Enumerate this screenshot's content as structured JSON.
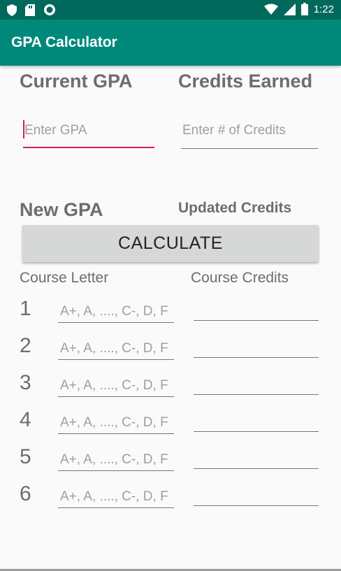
{
  "status_bar": {
    "time": "1:22",
    "icons": [
      "shield-icon",
      "sd-card-icon",
      "record-icon",
      "wifi-icon",
      "signal-icon",
      "battery-icon"
    ]
  },
  "app_bar": {
    "title": "GPA Calculator"
  },
  "current": {
    "gpa_label": "Current GPA",
    "credits_label": "Credits Earned",
    "gpa_placeholder": "Enter GPA",
    "credits_placeholder": "Enter # of Credits"
  },
  "result": {
    "new_gpa_label": "New GPA",
    "updated_credits_label": "Updated Credits"
  },
  "calculate_label": "CALCULATE",
  "courses": {
    "letter_header": "Course Letter",
    "credits_header": "Course Credits",
    "rows": [
      {
        "num": "1",
        "letter_placeholder": "A+, A, ...., C-, D, F"
      },
      {
        "num": "2",
        "letter_placeholder": "A+, A, ...., C-, D, F"
      },
      {
        "num": "3",
        "letter_placeholder": "A+, A, ...., C-, D, F"
      },
      {
        "num": "4",
        "letter_placeholder": "A+, A, ...., C-, D, F"
      },
      {
        "num": "5",
        "letter_placeholder": "A+, A, ...., C-, D, F"
      },
      {
        "num": "6",
        "letter_placeholder": "A+, A, ...., C-, D, F"
      }
    ]
  },
  "colors": {
    "status_bar": "#00695c",
    "app_bar": "#00897b",
    "accent": "#d81b60"
  }
}
